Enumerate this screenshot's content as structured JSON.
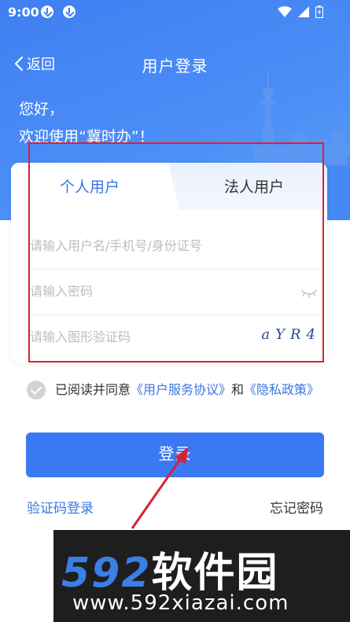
{
  "status": {
    "time": "9:00"
  },
  "nav": {
    "back_label": "返回",
    "title": "用户登录"
  },
  "greeting": {
    "line1": "您好，",
    "line2": "欢迎使用“冀时办”！"
  },
  "tabs": [
    {
      "label": "个人用户",
      "active": true
    },
    {
      "label": "法人用户",
      "active": false
    }
  ],
  "form": {
    "username_placeholder": "请输入用户名/手机号/身份证号",
    "password_placeholder": "请输入密码",
    "captcha_placeholder": "请输入图形验证码",
    "captcha_text": "aYR4"
  },
  "agreement": {
    "prefix": "已阅读并同意",
    "service_link": "《用户服务协议》",
    "conjunction": "和",
    "privacy_link": "《隐私政策》"
  },
  "login_button": "登录",
  "sms_login": "验证码登录",
  "forgot_password": "忘记密码",
  "watermark": {
    "brand_num": "592",
    "brand_cn": "软件园",
    "url": "www.592xiazai.com"
  },
  "colors": {
    "primary": "#3b78f3",
    "link": "#3a76e0",
    "annotation": "#d62238"
  },
  "icons": [
    "download-icon",
    "wifi-icon",
    "signal-icon",
    "battery-icon",
    "chevron-left-icon",
    "eye-closed-icon",
    "check-icon"
  ]
}
